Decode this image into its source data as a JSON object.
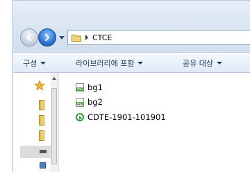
{
  "address": {
    "path": "CTCE"
  },
  "toolbar": {
    "organize_label": "구성",
    "include_library_label": "라이브러리에 포함",
    "share_label": "공유 대상"
  },
  "files": [
    {
      "name": "bg1",
      "icon": "png-file-icon"
    },
    {
      "name": "bg2",
      "icon": "png-file-icon"
    },
    {
      "name": "CDTE-1901-101901",
      "icon": "media-play-icon"
    }
  ]
}
